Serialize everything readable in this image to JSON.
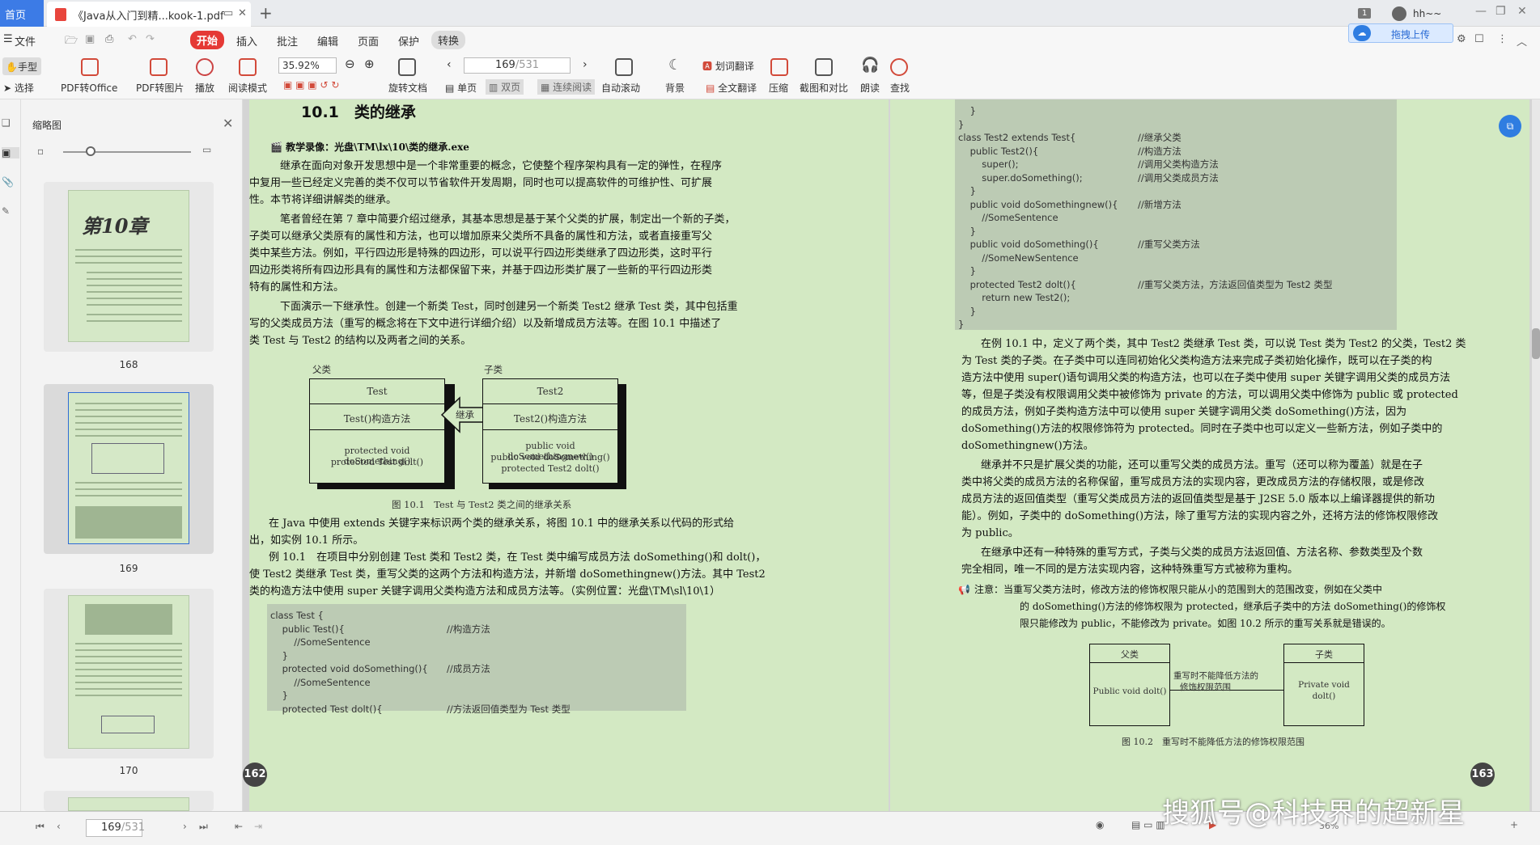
{
  "tabs": {
    "home": "首页",
    "doc": "《Java从入门到精...kook-1.pdf"
  },
  "titlebar": {
    "badge": "1",
    "user": "hh~~",
    "upload": "拖拽上传"
  },
  "menu": [
    "文件",
    "开始",
    "插入",
    "批注",
    "编辑",
    "页面",
    "保护",
    "转换"
  ],
  "toolbar": {
    "hand": "手型",
    "select": "选择",
    "pdf_office": "PDF转Office",
    "pdf_image": "PDF转图片",
    "play": "播放",
    "read_mode": "阅读模式",
    "zoom": "35.92%",
    "page_current": "169",
    "page_total": "/531",
    "rotate": "旋转文档",
    "single": "单页",
    "double": "双页",
    "continuous": "连续阅读",
    "autoscroll": "自动滚动",
    "background": "背景",
    "word_translate": "划词翻译",
    "full_translate": "全文翻译",
    "compress": "压缩",
    "screenshot": "截图和对比",
    "read_aloud": "朗读",
    "find": "查找"
  },
  "panel": {
    "title": "缩略图",
    "thumbs": [
      "168",
      "169",
      "170"
    ]
  },
  "left_page": {
    "heading": "10.1　类的继承",
    "video": "教学录像：光盘\\TM\\lx\\10\\类的继承.exe",
    "p1": [
      "继承在面向对象开发思想中是一个非常重要的概念，它使整个程序架构具有一定的弹性，在程序",
      "中复用一些已经定义完善的类不仅可以节省软件开发周期，同时也可以提高软件的可维护性、可扩展",
      "性。本节将详细讲解类的继承。"
    ],
    "p2": [
      "笔者曾经在第 7 章中简要介绍过继承，其基本思想是基于某个父类的扩展，制定出一个新的子类，",
      "子类可以继承父类原有的属性和方法，也可以增加原来父类所不具备的属性和方法，或者直接重写父",
      "类中某些方法。例如，平行四边形是特殊的四边形，可以说平行四边形类继承了四边形类，这时平行",
      "四边形类将所有四边形具有的属性和方法都保留下来，并基于四边形类扩展了一些新的平行四边形类",
      "特有的属性和方法。"
    ],
    "p3": [
      "下面演示一下继承性。创建一个新类 Test，同时创建另一个新类 Test2 继承 Test 类，其中包括重",
      "写的父类成员方法（重写的概念将在下文中进行详细介绍）以及新增成员方法等。在图 10.1 中描述了",
      "类 Test 与 Test2 的结构以及两者之间的关系。"
    ],
    "diagram": {
      "parent_label": "父类",
      "child_label": "子类",
      "test": "Test",
      "test_ctor": "Test()构造方法",
      "test_methods": [
        "protected void doSomething()",
        "protected Test dolt()"
      ],
      "test2": "Test2",
      "test2_ctor": "Test2()构造方法",
      "test2_methods": [
        "public void doSomethingnew()",
        "public void doSomething()",
        "protected Test2 dolt()"
      ],
      "arrow": "继承",
      "caption": "图 10.1　Test 与 Test2 类之间的继承关系"
    },
    "p4": [
      "在 Java 中使用 extends 关键字来标识两个类的继承关系，将图 10.1 中的继承关系以代码的形式给",
      "出，如实例 10.1 所示。"
    ],
    "p5": [
      "例 10.1　在项目中分别创建 Test 类和 Test2 类，在 Test 类中编写成员方法 doSomething()和 dolt()，",
      "使 Test2 类继承 Test 类，重写父类的这两个方法和构造方法，并新增 doSomethingnew()方法。其中 Test2",
      "类的构造方法中使用 super 关键字调用父类构造方法和成员方法等。（实例位置：光盘\\TM\\sl\\10\\1）"
    ],
    "code": [
      [
        "class Test {",
        ""
      ],
      [
        "    public Test(){",
        "//构造方法"
      ],
      [
        "        //SomeSentence",
        ""
      ],
      [
        "    }",
        ""
      ],
      [
        "    protected void doSomething(){",
        "//成员方法"
      ],
      [
        "        //SomeSentence",
        ""
      ],
      [
        "    }",
        ""
      ],
      [
        "    protected Test dolt(){",
        "//方法返回值类型为 Test 类型"
      ]
    ],
    "page_no": "162"
  },
  "right_page": {
    "code": [
      [
        "    }",
        ""
      ],
      [
        "}",
        ""
      ],
      [
        "class Test2 extends Test{",
        "//继承父类"
      ],
      [
        "    public Test2(){",
        "//构造方法"
      ],
      [
        "        super();",
        "//调用父类构造方法"
      ],
      [
        "        super.doSomething();",
        "//调用父类成员方法"
      ],
      [
        "    }",
        ""
      ],
      [
        "    public void doSomethingnew(){",
        "//新增方法"
      ],
      [
        "        //SomeSentence",
        ""
      ],
      [
        "    }",
        ""
      ],
      [
        "    public void doSomething(){",
        "//重写父类方法"
      ],
      [
        "        //SomeNewSentence",
        ""
      ],
      [
        "    }",
        ""
      ],
      [
        "    protected Test2 dolt(){",
        "//重写父类方法，方法返回值类型为 Test2 类型"
      ],
      [
        "        return new Test2();",
        ""
      ],
      [
        "    }",
        ""
      ],
      [
        "}",
        ""
      ]
    ],
    "p1": [
      "在例 10.1 中，定义了两个类，其中 Test2 类继承 Test 类，可以说 Test 类为 Test2 的父类，Test2 类",
      "为 Test 类的子类。在子类中可以连同初始化父类构造方法来完成子类初始化操作，既可以在子类的构",
      "造方法中使用 super()语句调用父类的构造方法，也可以在子类中使用 super 关键字调用父类的成员方法",
      "等，但是子类没有权限调用父类中被修饰为 private 的方法，可以调用父类中修饰为 public 或 protected",
      "的成员方法，例如子类构造方法中可以使用 super 关键字调用父类 doSomething()方法，因为",
      "doSomething()方法的权限修饰符为 protected。同时在子类中也可以定义一些新方法，例如子类中的",
      "doSomethingnew()方法。"
    ],
    "p2": [
      "继承并不只是扩展父类的功能，还可以重写父类的成员方法。重写（还可以称为覆盖）就是在子",
      "类中将父类的成员方法的名称保留，重写成员方法的实现内容，更改成员方法的存储权限，或是修改",
      "成员方法的返回值类型（重写父类成员方法的返回值类型是基于 J2SE 5.0 版本以上编译器提供的新功",
      "能）。例如，子类中的 doSomething()方法，除了重写方法的实现内容之外，还将方法的修饰权限修改",
      "为 public。"
    ],
    "p3": [
      "在继承中还有一种特殊的重写方式，子类与父类的成员方法返回值、方法名称、参数类型及个数",
      "完全相同，唯一不同的是方法实现内容，这种特殊重写方式被称为重构。"
    ],
    "note": [
      "注意：当重写父类方法时，修改方法的修饰权限只能从小的范围到大的范围改变，例如在父类中",
      "的 doSomething()方法的修饰权限为 protected，继承后子类中的方法 doSomething()的修饰权",
      "限只能修改为 public，不能修改为 private。如图 10.2 所示的重写关系就是错误的。"
    ],
    "diagram": {
      "parent": "父类",
      "child": "子类",
      "parent_method": "Public void dolt()",
      "child_method": [
        "Private void",
        "dolt()"
      ],
      "arrow_text": [
        "重写时不能降低方法的",
        "修饰权限范围"
      ],
      "caption": "图 10.2　重写时不能降低方法的修饰权限范围"
    },
    "page_no": "163"
  },
  "statusbar": {
    "page": "169",
    "total": "/531",
    "zoom": "36%"
  },
  "watermark": "搜狐号@科技界的超新星"
}
